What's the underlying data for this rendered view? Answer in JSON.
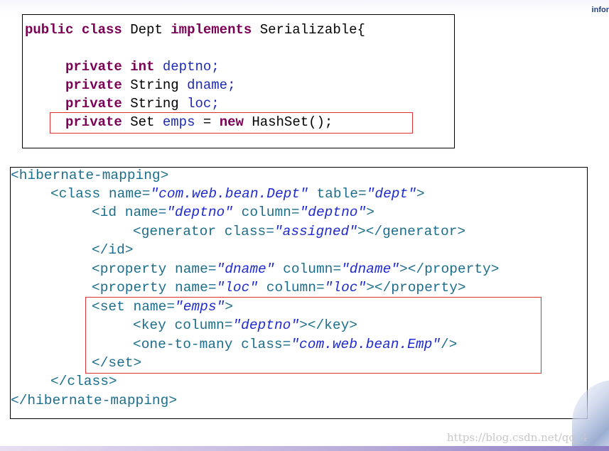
{
  "corner_label": "infor",
  "watermark": "https://blog.csdn.net/qq_4",
  "java": {
    "line0": {
      "k1": "public",
      "k2": "class",
      "name": "Dept",
      "k3": "implements",
      "iface": "Serializable{"
    },
    "line1": {
      "k1": "private",
      "k2": "int",
      "var": "deptno;"
    },
    "line2": {
      "k1": "private",
      "type": "String",
      "var": "dname;"
    },
    "line3": {
      "k1": "private",
      "type": "String",
      "var": "loc;"
    },
    "line4": {
      "k1": "private",
      "type": "Set",
      "var": "emps",
      "eq": "=",
      "k2": "new",
      "rest": "HashSet();"
    }
  },
  "xml": {
    "l0": "<hibernate-mapping>",
    "l1": {
      "open": "<class name=",
      "v1": "\"com.web.bean.Dept\"",
      "mid": " table=",
      "v2": "\"dept\"",
      "close": ">"
    },
    "l2": {
      "open": "<id name=",
      "v1": "\"deptno\"",
      "mid": " column=",
      "v2": "\"deptno\"",
      "close": ">"
    },
    "l3": {
      "open": "<generator class=",
      "v1": "\"assigned\"",
      "close": "></generator>"
    },
    "l4": "</id>",
    "l5": {
      "open": "<property name=",
      "v1": "\"dname\"",
      "mid": " column=",
      "v2": "\"dname\"",
      "close": "></property>"
    },
    "l6": {
      "open": "<property name=",
      "v1": "\"loc\"",
      "mid": " column=",
      "v2": "\"loc\"",
      "close": "></property>"
    },
    "l7": {
      "open": "<set name=",
      "v1": "\"emps\"",
      "close": ">"
    },
    "l8": {
      "open": "<key column=",
      "v1": "\"deptno\"",
      "close": "></key>"
    },
    "l9": {
      "open": "<one-to-many class=",
      "v1": "\"com.web.bean.Emp\"",
      "close": "/>"
    },
    "l10": "</set>",
    "l11": "</class>",
    "l12": "</hibernate-mapping>"
  },
  "colors": {
    "keyword": "#7a0055",
    "identifier": "#1d2bb3",
    "xml_tag": "#1c6e8c",
    "xml_value": "#1f2bd0",
    "highlight": "#e03131"
  }
}
